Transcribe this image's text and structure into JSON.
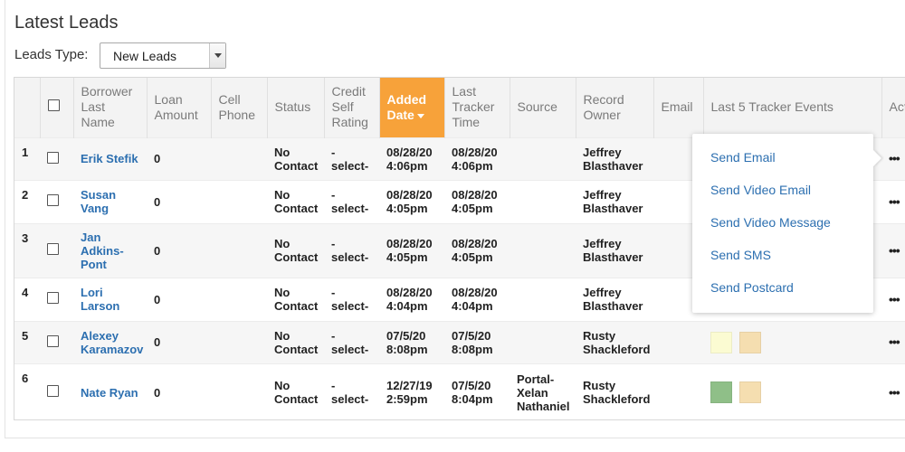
{
  "title": "Latest Leads",
  "filter": {
    "label": "Leads Type:",
    "value": "New Leads"
  },
  "columns": {
    "borrower": [
      "Borrower",
      "Last",
      "Name"
    ],
    "loan": [
      "Loan",
      "Amount"
    ],
    "cell": [
      "Cell",
      "Phone"
    ],
    "status": "Status",
    "credit": [
      "Credit",
      "Self",
      "Rating"
    ],
    "added": [
      "Added",
      "Date"
    ],
    "last_tracker": [
      "Last",
      "Tracker",
      "Time"
    ],
    "source": "Source",
    "owner": [
      "Record",
      "Owner"
    ],
    "email": "Email",
    "events": "Last 5 Tracker Events",
    "actions": "Acti"
  },
  "rows": [
    {
      "num": "1",
      "name": "Erik Stefik",
      "loan": "0",
      "status": [
        "No",
        "Contact"
      ],
      "credit": "-select-",
      "added": [
        "08/28/20",
        "4:06pm"
      ],
      "tracker": [
        "08/28/20",
        "4:06pm"
      ],
      "source": [],
      "owner": [
        "Jeffrey",
        "Blasthaver"
      ],
      "swatches": []
    },
    {
      "num": "2",
      "name": "Susan Vang",
      "loan": "0",
      "status": [
        "No",
        "Contact"
      ],
      "credit": "-select-",
      "added": [
        "08/28/20",
        "4:05pm"
      ],
      "tracker": [
        "08/28/20",
        "4:05pm"
      ],
      "source": [],
      "owner": [
        "Jeffrey",
        "Blasthaver"
      ],
      "swatches": []
    },
    {
      "num": "3",
      "name": "Jan Adkins-Pont",
      "loan": "0",
      "status": [
        "No",
        "Contact"
      ],
      "credit": "-select-",
      "added": [
        "08/28/20",
        "4:05pm"
      ],
      "tracker": [
        "08/28/20",
        "4:05pm"
      ],
      "source": [],
      "owner": [
        "Jeffrey",
        "Blasthaver"
      ],
      "swatches": []
    },
    {
      "num": "4",
      "name": "Lori Larson",
      "loan": "0",
      "status": [
        "No",
        "Contact"
      ],
      "credit": "-select-",
      "added": [
        "08/28/20",
        "4:04pm"
      ],
      "tracker": [
        "08/28/20",
        "4:04pm"
      ],
      "source": [],
      "owner": [
        "Jeffrey",
        "Blasthaver"
      ],
      "swatches": []
    },
    {
      "num": "5",
      "name": "Alexey Karamazov",
      "loan": "0",
      "status": [
        "No",
        "Contact"
      ],
      "credit": "-select-",
      "added": [
        "07/5/20",
        "8:08pm"
      ],
      "tracker": [
        "07/5/20",
        "8:08pm"
      ],
      "source": [],
      "owner": [
        "Rusty",
        "Shackleford"
      ],
      "swatches": [
        "#fbfbd2",
        "#f5deb0"
      ]
    },
    {
      "num": "6",
      "name": "Nate Ryan",
      "loan": "0",
      "status": [
        "No",
        "Contact"
      ],
      "credit": "-select-",
      "added": [
        "12/27/19",
        "2:59pm"
      ],
      "tracker": [
        "07/5/20",
        "8:04pm"
      ],
      "source": [
        "Portal-",
        "Xelan",
        "Nathaniel"
      ],
      "owner": [
        "Rusty",
        "Shackleford"
      ],
      "swatches": [
        "#8fbf88",
        "#f5deb0"
      ]
    }
  ],
  "popup": {
    "items": [
      "Send Email",
      "Send Video Email",
      "Send Video Message",
      "Send SMS",
      "Send Postcard"
    ]
  },
  "colors": {
    "link": "#2c6fb0",
    "sorted_header": "#f7a23a"
  }
}
